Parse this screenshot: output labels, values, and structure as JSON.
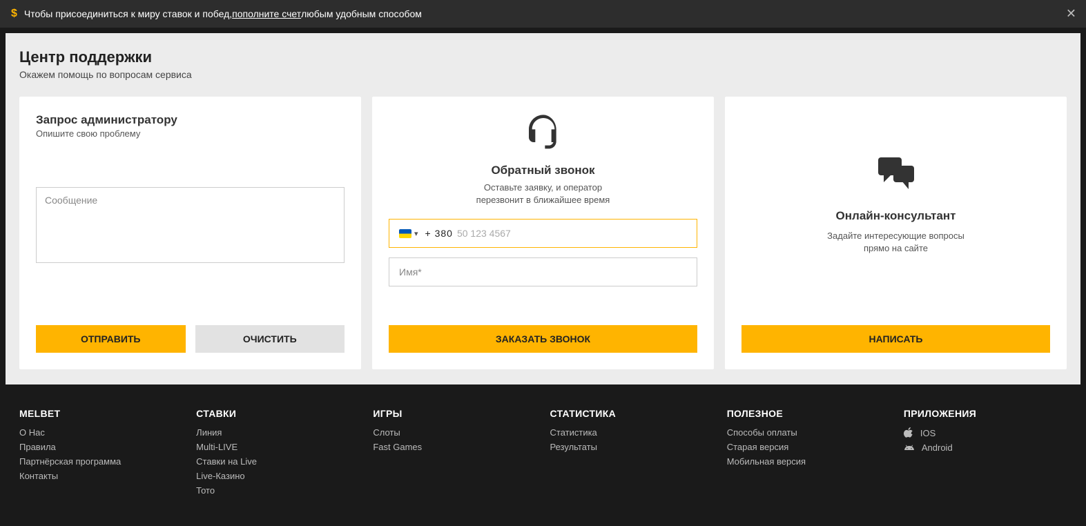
{
  "banner": {
    "text_before": "Чтобы присоединиться к миру ставок и побед, ",
    "text_link": "пополните счет",
    "text_after": " любым удобным способом"
  },
  "page": {
    "title": "Центр поддержки",
    "subtitle": "Окажем помощь по вопросам сервиса"
  },
  "admin": {
    "title": "Запрос администратору",
    "subtitle": "Опишите свою проблему",
    "message_placeholder": "Сообщение",
    "send": "ОТПРАВИТЬ",
    "clear": "ОЧИСТИТЬ"
  },
  "callback": {
    "title": "Обратный звонок",
    "sub_line1": "Оставьте заявку, и оператор",
    "sub_line2": "перезвонит в ближайшее время",
    "phone_prefix": "+ 380",
    "phone_placeholder": "50 123 4567",
    "name_placeholder": "Имя*",
    "order": "ЗАКАЗАТЬ ЗВОНОК"
  },
  "online": {
    "title": "Онлайн-консультант",
    "sub_line1": "Задайте интересующие вопросы",
    "sub_line2": "прямо на сайте",
    "write": "НАПИСАТЬ"
  },
  "footer": {
    "col1": {
      "title": "MELBET",
      "links": [
        "О Нас",
        "Правила",
        "Партнёрская программа",
        "Контакты"
      ]
    },
    "col2": {
      "title": "СТАВКИ",
      "links": [
        "Линия",
        "Multi-LIVE",
        "Ставки на Live",
        "Live-Казино",
        "Тото"
      ]
    },
    "col3": {
      "title": "ИГРЫ",
      "links": [
        "Слоты",
        "Fast Games"
      ]
    },
    "col4": {
      "title": "СТАТИСТИКА",
      "links": [
        "Статистика",
        "Результаты"
      ]
    },
    "col5": {
      "title": "ПОЛЕЗНОЕ",
      "links": [
        "Способы оплаты",
        "Старая версия",
        "Мобильная версия"
      ]
    },
    "col6": {
      "title": "ПРИЛОЖЕНИЯ",
      "apps": [
        {
          "name": "IOS",
          "icon": "apple"
        },
        {
          "name": "Android",
          "icon": "android"
        }
      ]
    }
  }
}
